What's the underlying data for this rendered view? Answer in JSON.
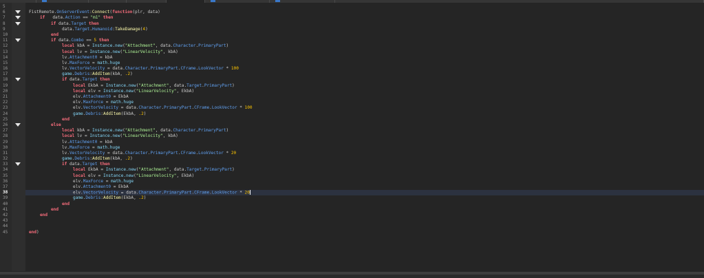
{
  "editor": {
    "tabs": [
      {
        "w": 53,
        "active": false,
        "mark": false
      },
      {
        "w": 76,
        "active": false,
        "mark": true
      },
      {
        "w": 55,
        "active": false,
        "mark": false
      },
      {
        "w": 58,
        "active": false,
        "mark": false
      },
      {
        "w": 56,
        "active": true,
        "mark": false
      },
      {
        "w": 94,
        "active": false,
        "mark": true
      },
      {
        "w": 95,
        "active": false,
        "mark": true
      },
      {
        "w": 536,
        "active": false,
        "mark": false
      }
    ],
    "current_line": 38,
    "lines": [
      {
        "n": "5",
        "i": 0,
        "fold": false,
        "tokens": []
      },
      {
        "n": "6",
        "i": 0,
        "fold": true,
        "tokens": [
          [
            "t",
            "FistRemote."
          ],
          [
            "p",
            "OnServerEvent"
          ],
          [
            "t",
            ":"
          ],
          [
            "f",
            "Connect"
          ],
          [
            "t",
            "("
          ],
          [
            "k",
            "function"
          ],
          [
            "t",
            "(plr, data)"
          ]
        ]
      },
      {
        "n": "7",
        "i": 1,
        "fold": true,
        "tokens": [
          [
            "k",
            "if"
          ],
          [
            "t",
            "   data."
          ],
          [
            "p",
            "Action"
          ],
          [
            "t",
            " == "
          ],
          [
            "s",
            "\"m1\""
          ],
          [
            "t",
            " "
          ],
          [
            "k",
            "then"
          ]
        ]
      },
      {
        "n": "8",
        "i": 2,
        "fold": true,
        "tokens": [
          [
            "k",
            "if"
          ],
          [
            "t",
            " data."
          ],
          [
            "p",
            "Target"
          ],
          [
            "t",
            " "
          ],
          [
            "k",
            "then"
          ]
        ]
      },
      {
        "n": "9",
        "i": 3,
        "fold": false,
        "tokens": [
          [
            "t",
            "data."
          ],
          [
            "p",
            "Target"
          ],
          [
            "t",
            "."
          ],
          [
            "p",
            "Humanoid"
          ],
          [
            "t",
            ":"
          ],
          [
            "f",
            "TakeDamage"
          ],
          [
            "t",
            "("
          ],
          [
            "n",
            "4"
          ],
          [
            "t",
            ")"
          ]
        ]
      },
      {
        "n": "10",
        "i": 2,
        "fold": false,
        "tokens": [
          [
            "k",
            "end"
          ]
        ]
      },
      {
        "n": "11",
        "i": 2,
        "fold": true,
        "tokens": [
          [
            "k",
            "if"
          ],
          [
            "t",
            " data."
          ],
          [
            "p",
            "Combo"
          ],
          [
            "t",
            " == "
          ],
          [
            "n",
            "5"
          ],
          [
            "t",
            " "
          ],
          [
            "k",
            "then"
          ]
        ]
      },
      {
        "n": "12",
        "i": 3,
        "fold": false,
        "tokens": [
          [
            "k",
            "local"
          ],
          [
            "t",
            " kbA = "
          ],
          [
            "b",
            "Instance.new"
          ],
          [
            "t",
            "("
          ],
          [
            "s",
            "\"Attachment\""
          ],
          [
            "t",
            ", data."
          ],
          [
            "p",
            "Character"
          ],
          [
            "t",
            "."
          ],
          [
            "p",
            "PrimaryPart"
          ],
          [
            "t",
            ")"
          ]
        ]
      },
      {
        "n": "13",
        "i": 3,
        "fold": false,
        "tokens": [
          [
            "k",
            "local"
          ],
          [
            "t",
            " lv = "
          ],
          [
            "b",
            "Instance.new"
          ],
          [
            "t",
            "("
          ],
          [
            "s",
            "\"LinearVelocity\""
          ],
          [
            "t",
            ", kbA)"
          ]
        ]
      },
      {
        "n": "14",
        "i": 3,
        "fold": false,
        "tokens": [
          [
            "t",
            "lv."
          ],
          [
            "p",
            "Attachment0"
          ],
          [
            "t",
            " = kbA"
          ]
        ]
      },
      {
        "n": "15",
        "i": 3,
        "fold": false,
        "tokens": [
          [
            "t",
            "lv."
          ],
          [
            "p",
            "MaxForce"
          ],
          [
            "t",
            " = "
          ],
          [
            "b",
            "math.huge"
          ]
        ]
      },
      {
        "n": "16",
        "i": 3,
        "fold": false,
        "tokens": [
          [
            "t",
            "lv."
          ],
          [
            "p",
            "VectorVelocity"
          ],
          [
            "t",
            " = data."
          ],
          [
            "p",
            "Character"
          ],
          [
            "t",
            "."
          ],
          [
            "p",
            "PrimaryPart"
          ],
          [
            "t",
            "."
          ],
          [
            "p",
            "CFrame"
          ],
          [
            "t",
            "."
          ],
          [
            "p",
            "LookVector"
          ],
          [
            "t",
            " * "
          ],
          [
            "n",
            "100"
          ]
        ]
      },
      {
        "n": "17",
        "i": 3,
        "fold": false,
        "tokens": [
          [
            "b",
            "game"
          ],
          [
            "t",
            "."
          ],
          [
            "p",
            "Debris"
          ],
          [
            "t",
            ":"
          ],
          [
            "f",
            "AddItem"
          ],
          [
            "t",
            "(kbA, "
          ],
          [
            "n",
            ".2"
          ],
          [
            "t",
            ")"
          ]
        ]
      },
      {
        "n": "18",
        "i": 3,
        "fold": true,
        "tokens": [
          [
            "k",
            "if"
          ],
          [
            "t",
            " data."
          ],
          [
            "p",
            "Target"
          ],
          [
            "t",
            " "
          ],
          [
            "k",
            "then"
          ]
        ]
      },
      {
        "n": "19",
        "i": 4,
        "fold": false,
        "tokens": [
          [
            "k",
            "local"
          ],
          [
            "t",
            " EkbA = "
          ],
          [
            "b",
            "Instance.new"
          ],
          [
            "t",
            "("
          ],
          [
            "s",
            "\"Attachment\""
          ],
          [
            "t",
            ", data."
          ],
          [
            "p",
            "Target"
          ],
          [
            "t",
            "."
          ],
          [
            "p",
            "PrimaryPart"
          ],
          [
            "t",
            ")"
          ]
        ]
      },
      {
        "n": "20",
        "i": 4,
        "fold": false,
        "tokens": [
          [
            "k",
            "local"
          ],
          [
            "t",
            " elv = "
          ],
          [
            "b",
            "Instance.new"
          ],
          [
            "t",
            "("
          ],
          [
            "s",
            "\"LinearVelocity\""
          ],
          [
            "t",
            ", EkbA)"
          ]
        ]
      },
      {
        "n": "21",
        "i": 4,
        "fold": false,
        "tokens": [
          [
            "t",
            "elv."
          ],
          [
            "p",
            "Attachment0"
          ],
          [
            "t",
            " = EkbA"
          ]
        ]
      },
      {
        "n": "22",
        "i": 4,
        "fold": false,
        "tokens": [
          [
            "t",
            "elv."
          ],
          [
            "p",
            "MaxForce"
          ],
          [
            "t",
            " = "
          ],
          [
            "b",
            "math.huge"
          ]
        ]
      },
      {
        "n": "23",
        "i": 4,
        "fold": false,
        "tokens": [
          [
            "t",
            "elv."
          ],
          [
            "p",
            "VectorVelocity"
          ],
          [
            "t",
            " = data."
          ],
          [
            "p",
            "Character"
          ],
          [
            "t",
            "."
          ],
          [
            "p",
            "PrimaryPart"
          ],
          [
            "t",
            "."
          ],
          [
            "p",
            "CFrame"
          ],
          [
            "t",
            "."
          ],
          [
            "p",
            "LookVector"
          ],
          [
            "t",
            " * "
          ],
          [
            "n",
            "100"
          ]
        ]
      },
      {
        "n": "24",
        "i": 4,
        "fold": false,
        "tokens": [
          [
            "b",
            "game"
          ],
          [
            "t",
            "."
          ],
          [
            "p",
            "Debris"
          ],
          [
            "t",
            ":"
          ],
          [
            "f",
            "AddItem"
          ],
          [
            "t",
            "(EkbA, "
          ],
          [
            "n",
            ".2"
          ],
          [
            "t",
            ")"
          ]
        ]
      },
      {
        "n": "25",
        "i": 3,
        "fold": false,
        "tokens": [
          [
            "k",
            "end"
          ]
        ]
      },
      {
        "n": "26",
        "i": 2,
        "fold": true,
        "tokens": [
          [
            "k",
            "else"
          ]
        ]
      },
      {
        "n": "27",
        "i": 3,
        "fold": false,
        "tokens": [
          [
            "k",
            "local"
          ],
          [
            "t",
            " kbA = "
          ],
          [
            "b",
            "Instance.new"
          ],
          [
            "t",
            "("
          ],
          [
            "s",
            "\"Attachment\""
          ],
          [
            "t",
            ", data."
          ],
          [
            "p",
            "Character"
          ],
          [
            "t",
            "."
          ],
          [
            "p",
            "PrimaryPart"
          ],
          [
            "t",
            ")"
          ]
        ]
      },
      {
        "n": "28",
        "i": 3,
        "fold": false,
        "tokens": [
          [
            "k",
            "local"
          ],
          [
            "t",
            " lv = "
          ],
          [
            "b",
            "Instance.new"
          ],
          [
            "t",
            "("
          ],
          [
            "s",
            "\"LinearVelocity\""
          ],
          [
            "t",
            ", kbA)"
          ]
        ]
      },
      {
        "n": "29",
        "i": 3,
        "fold": false,
        "tokens": [
          [
            "t",
            "lv."
          ],
          [
            "p",
            "Attachment0"
          ],
          [
            "t",
            " = kbA"
          ]
        ]
      },
      {
        "n": "30",
        "i": 3,
        "fold": false,
        "tokens": [
          [
            "t",
            "lv."
          ],
          [
            "p",
            "MaxForce"
          ],
          [
            "t",
            " = "
          ],
          [
            "b",
            "math.huge"
          ]
        ]
      },
      {
        "n": "31",
        "i": 3,
        "fold": false,
        "tokens": [
          [
            "t",
            "lv."
          ],
          [
            "p",
            "VectorVelocity"
          ],
          [
            "t",
            " = data."
          ],
          [
            "p",
            "Character"
          ],
          [
            "t",
            "."
          ],
          [
            "p",
            "PrimaryPart"
          ],
          [
            "t",
            "."
          ],
          [
            "p",
            "CFrame"
          ],
          [
            "t",
            "."
          ],
          [
            "p",
            "LookVector"
          ],
          [
            "t",
            " * "
          ],
          [
            "n",
            "20"
          ]
        ]
      },
      {
        "n": "32",
        "i": 3,
        "fold": false,
        "tokens": [
          [
            "b",
            "game"
          ],
          [
            "t",
            "."
          ],
          [
            "p",
            "Debris"
          ],
          [
            "t",
            ":"
          ],
          [
            "f",
            "AddItem"
          ],
          [
            "t",
            "(kbA, "
          ],
          [
            "n",
            ".2"
          ],
          [
            "t",
            ")"
          ]
        ]
      },
      {
        "n": "33",
        "i": 3,
        "fold": true,
        "tokens": [
          [
            "k",
            "if"
          ],
          [
            "t",
            " data."
          ],
          [
            "p",
            "Target"
          ],
          [
            "t",
            " "
          ],
          [
            "k",
            "then"
          ]
        ]
      },
      {
        "n": "34",
        "i": 4,
        "fold": false,
        "tokens": [
          [
            "k",
            "local"
          ],
          [
            "t",
            " EkbA = "
          ],
          [
            "b",
            "Instance.new"
          ],
          [
            "t",
            "("
          ],
          [
            "s",
            "\"Attachment\""
          ],
          [
            "t",
            ", data."
          ],
          [
            "p",
            "Target"
          ],
          [
            "t",
            "."
          ],
          [
            "p",
            "PrimaryPart"
          ],
          [
            "t",
            ")"
          ]
        ]
      },
      {
        "n": "35",
        "i": 4,
        "fold": false,
        "tokens": [
          [
            "k",
            "local"
          ],
          [
            "t",
            " elv = "
          ],
          [
            "b",
            "Instance.new"
          ],
          [
            "t",
            "("
          ],
          [
            "s",
            "\"LinearVelocity\""
          ],
          [
            "t",
            ", EkbA)"
          ]
        ]
      },
      {
        "n": "36",
        "i": 4,
        "fold": false,
        "tokens": [
          [
            "t",
            "elv."
          ],
          [
            "p",
            "MaxForce"
          ],
          [
            "t",
            " = "
          ],
          [
            "b",
            "math.huge"
          ]
        ]
      },
      {
        "n": "37",
        "i": 4,
        "fold": false,
        "tokens": [
          [
            "t",
            "elv."
          ],
          [
            "p",
            "Attachment0"
          ],
          [
            "t",
            " = EkbA"
          ]
        ]
      },
      {
        "n": "38",
        "i": 4,
        "fold": false,
        "tokens": [
          [
            "t",
            "elv."
          ],
          [
            "p",
            "VectorVelocity"
          ],
          [
            "t",
            " = data."
          ],
          [
            "p",
            "Character"
          ],
          [
            "t",
            "."
          ],
          [
            "p",
            "PrimaryPart"
          ],
          [
            "t",
            "."
          ],
          [
            "p",
            "CFrame"
          ],
          [
            "t",
            "."
          ],
          [
            "p",
            "LookVector"
          ],
          [
            "t",
            " * "
          ],
          [
            "n",
            "20"
          ]
        ]
      },
      {
        "n": "39",
        "i": 4,
        "fold": false,
        "tokens": [
          [
            "b",
            "game"
          ],
          [
            "t",
            "."
          ],
          [
            "p",
            "Debris"
          ],
          [
            "t",
            ":"
          ],
          [
            "f",
            "AddItem"
          ],
          [
            "t",
            "(EkbA, "
          ],
          [
            "n",
            ".2"
          ],
          [
            "t",
            ")"
          ]
        ]
      },
      {
        "n": "40",
        "i": 3,
        "fold": false,
        "tokens": [
          [
            "k",
            "end"
          ]
        ]
      },
      {
        "n": "41",
        "i": 2,
        "fold": false,
        "tokens": [
          [
            "k",
            "end"
          ]
        ]
      },
      {
        "n": "42",
        "i": 1,
        "fold": false,
        "tokens": [
          [
            "k",
            "end"
          ]
        ]
      },
      {
        "n": "43",
        "i": 0,
        "fold": false,
        "tokens": []
      },
      {
        "n": "44",
        "i": 0,
        "fold": false,
        "tokens": []
      },
      {
        "n": "45",
        "i": 0,
        "fold": false,
        "tokens": [
          [
            "k",
            "end"
          ],
          [
            "t",
            ")"
          ]
        ]
      }
    ]
  }
}
